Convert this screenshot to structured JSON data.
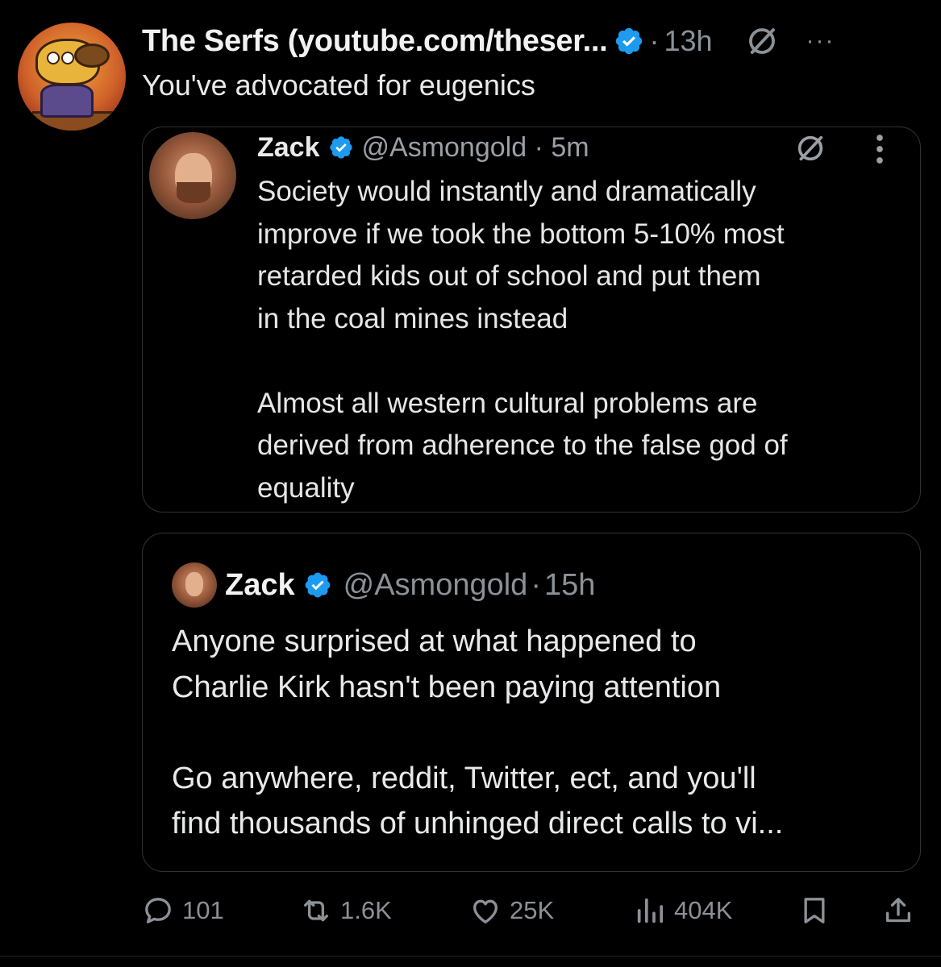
{
  "post": {
    "display_name": "The Serfs (youtube.com/theser...",
    "separator": "·",
    "time": "13h",
    "more": "···",
    "text": "You've advocated for eugenics",
    "avatar": "cartoon-dog-avatar"
  },
  "screenshot_image": {
    "name": "Zack",
    "handle": "@Asmongold",
    "time": "5m",
    "body": "Society would instantly and dramatically\nimprove if we took the bottom 5-10% most\nretarded kids out of school and put them\nin the coal mines instead\n\nAlmost all western cultural problems are\nderived from adherence to the false god of\nequality"
  },
  "quoted": {
    "name": "Zack",
    "handle": "@Asmongold",
    "separator": "·",
    "time": "15h",
    "text": "Anyone surprised at what happened to\nCharlie Kirk hasn't been paying attention\n\nGo anywhere, reddit, Twitter, ect, and you'll\nfind thousands of unhinged direct calls to vi..."
  },
  "actions": {
    "replies": "101",
    "reposts": "1.6K",
    "likes": "25K",
    "views": "404K"
  },
  "colors": {
    "background": "#000000",
    "verified": "#1d9bf0",
    "secondary_text": "#8b9197",
    "border": "#2f3336"
  },
  "icons": [
    "verified-badge-icon",
    "grok-icon",
    "more-icon",
    "reply-icon",
    "repost-icon",
    "like-icon",
    "views-icon",
    "bookmark-icon",
    "share-icon"
  ]
}
